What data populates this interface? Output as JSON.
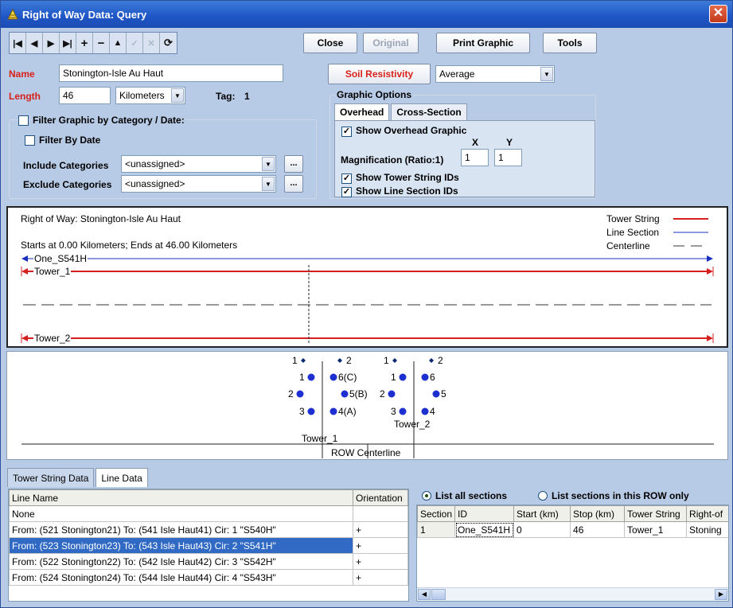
{
  "window": {
    "title": "Right of Way Data: Query"
  },
  "toolbar": {
    "close_label": "Close",
    "original_label": "Original",
    "print_label": "Print Graphic",
    "tools_label": "Tools"
  },
  "form": {
    "name_label": "Name",
    "name_value": "Stonington-Isle Au Haut",
    "length_label": "Length",
    "length_value": "46",
    "length_unit": "Kilometers",
    "tag_label": "Tag:",
    "tag_value": "1",
    "filter_label": "Filter Graphic by Category / Date:",
    "filter_date_label": "Filter By Date",
    "include_label": "Include Categories",
    "include_value": "<unassigned>",
    "exclude_label": "Exclude Categories",
    "exclude_value": "<unassigned>",
    "ellipsis": "...",
    "soil_label": "Soil Resistivity",
    "soil_value": "Average"
  },
  "graphic_options": {
    "title": "Graphic Options",
    "tabs": [
      "Overhead",
      "Cross-Section"
    ],
    "show_overhead": "Show Overhead Graphic",
    "magnification_label": "Magnification (Ratio:1)",
    "x_label": "X",
    "y_label": "Y",
    "x_value": "1",
    "y_value": "1",
    "show_tower_ids": "Show Tower String IDs",
    "show_line_ids": "Show Line Section IDs"
  },
  "graphic": {
    "row_title": "Right of Way: Stonington-Isle Au Haut",
    "extent": "Starts at  0.00 Kilometers; Ends at  46.00 Kilometers",
    "line_label": "One_S541H",
    "tower1_label": "Tower_1",
    "tower2_label": "Tower_2",
    "legend": {
      "tower_string": "Tower String",
      "line_section": "Line Section",
      "centerline": "Centerline"
    },
    "colors": {
      "tower_string": "#d42020",
      "line_section": "#1a2fbf",
      "centerline": "#333333"
    }
  },
  "tower_view": {
    "labels": {
      "a1": "1",
      "a2": "2",
      "a3": "1",
      "a4": "6(C)",
      "a5": "2",
      "a6": "5(B)",
      "a7": "3",
      "a8": "4(A)",
      "b1": "1",
      "b2": "2",
      "b3": "1",
      "b4": "6",
      "b5": "2",
      "b6": "5",
      "b7": "3",
      "b8": "4"
    },
    "tower1": "Tower_1",
    "tower2": "Tower_2",
    "centerline": "ROW Centerline"
  },
  "bottom": {
    "tabs": [
      "Tower String Data",
      "Line Data"
    ],
    "line_table": {
      "headers": [
        "Line Name",
        "Orientation"
      ],
      "rows": [
        [
          "None",
          ""
        ],
        [
          "From: (521 Stonington21) To: (541 Isle Haut41) Cir: 1 \"S540H\"",
          "+"
        ],
        [
          "From: (523 Stonington23) To: (543 Isle Haut43) Cir: 2 \"S541H\"",
          "+"
        ],
        [
          "From: (522 Stonington22) To: (542 Isle Haut42) Cir: 3 \"S542H\"",
          "+"
        ],
        [
          "From: (524 Stonington24) To: (544 Isle Haut44) Cir: 4 \"S543H\"",
          "+"
        ]
      ]
    },
    "radio_all": "List all sections",
    "radio_row": "List sections in this ROW only",
    "section_table": {
      "headers": [
        "Section",
        "ID",
        "Start (km)",
        "Stop (km)",
        "Tower String",
        "Right-of"
      ],
      "rows": [
        [
          "1",
          "One_S541H",
          "0",
          "46",
          "Tower_1",
          "Stoning"
        ]
      ]
    }
  }
}
